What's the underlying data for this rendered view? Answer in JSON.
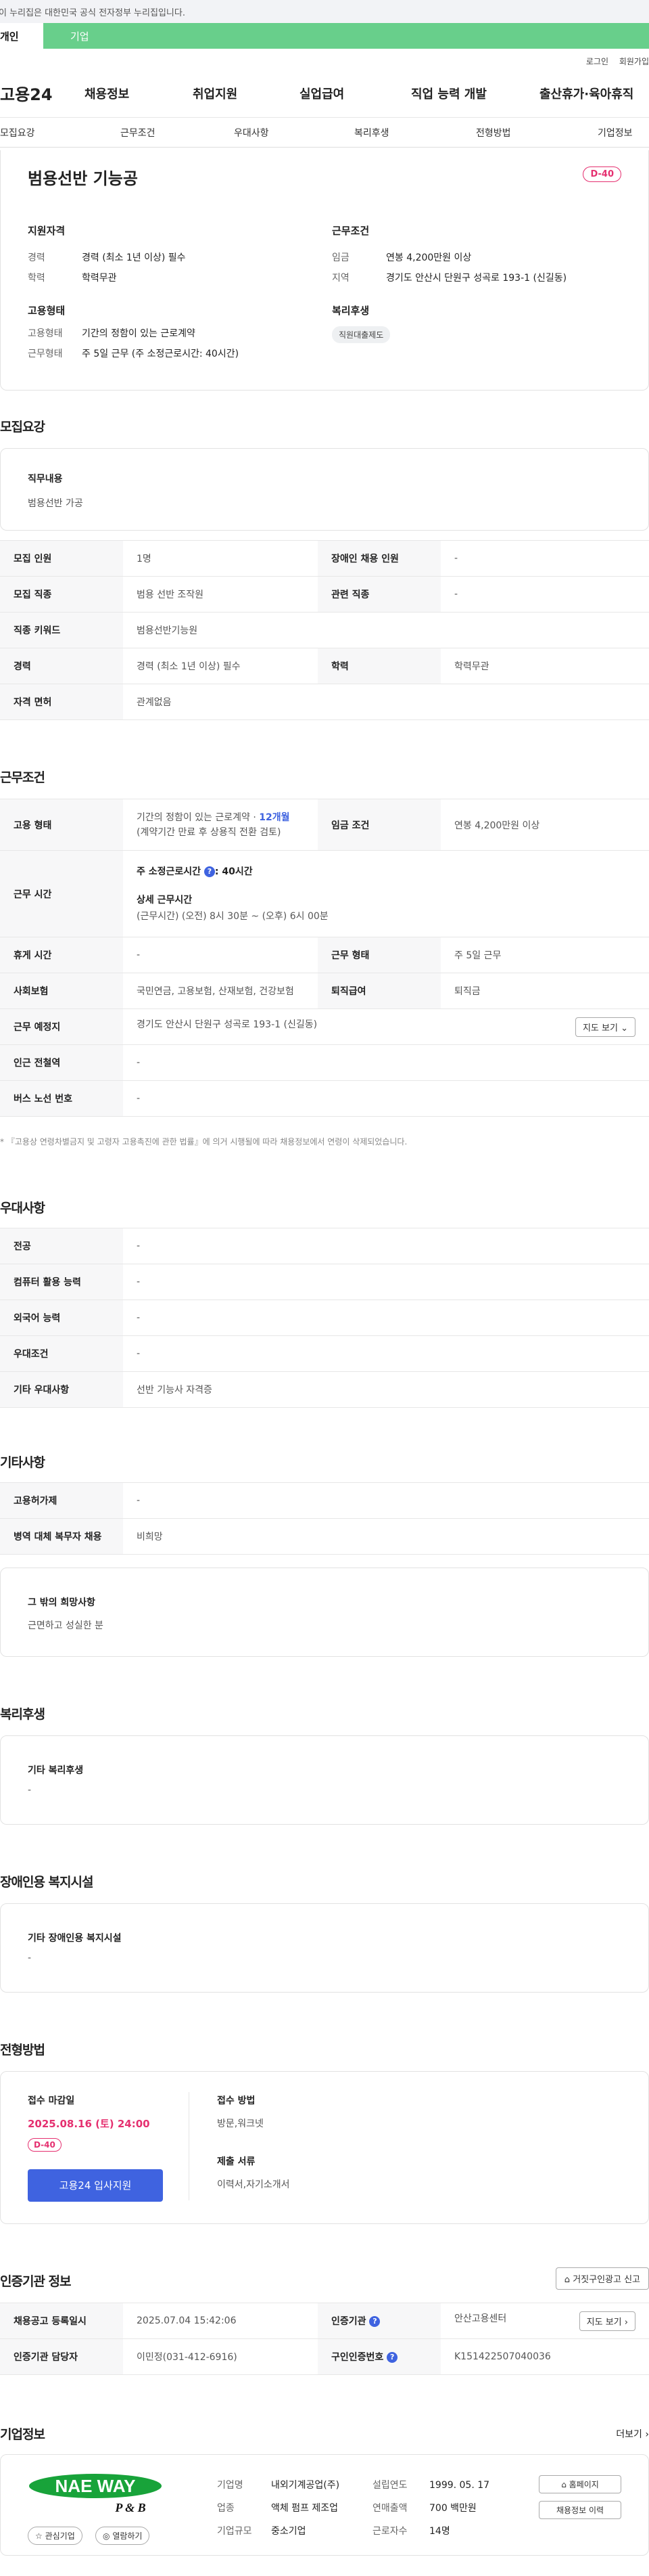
{
  "gov_banner": "이 누리집은 대한민국 공식 전자정부 누리집입니다.",
  "user_tabs": [
    "개인",
    "기업"
  ],
  "util": [
    "로그인",
    "회원가입"
  ],
  "logo": "고용24",
  "gnb": [
    "채용정보",
    "취업지원",
    "실업급여",
    "직업 능력 개발",
    "출산휴가·육아휴직"
  ],
  "subnav": [
    "모집요강",
    "근무조건",
    "우대사항",
    "복리후생",
    "전형방법",
    "기업정보"
  ],
  "summary": {
    "title": "범용선반 기능공",
    "dday": "D-40",
    "qual_h": "지원자격",
    "cond_h": "근무조건",
    "rows": [
      [
        "경력",
        "경력 (최소 1년 이상) 필수"
      ],
      [
        "학력",
        "학력무관"
      ]
    ],
    "crows": [
      [
        "임금",
        "연봉 4,200만원 이상"
      ],
      [
        "지역",
        "경기도 안산시 단원구 성곡로 193-1 (신길동)"
      ]
    ],
    "emp_h": "고용형태",
    "ben_h": "복리후생",
    "erows": [
      [
        "고용형태",
        "기간의 정함이 있는 근로계약"
      ],
      [
        "근무형태",
        "주 5일 근무 (주 소정근로시간: 40시간)"
      ]
    ],
    "ben_tag": "직원대출제도"
  },
  "recruit": {
    "h": "모집요강",
    "duty_l": "직무내용",
    "duty_v": "범용선반 가공",
    "rows": [
      [
        "모집 인원",
        "1명",
        "장애인 채용 인원",
        "-"
      ],
      [
        "모집 직종",
        "범용 선반 조작원",
        "관련 직종",
        "-"
      ],
      [
        "직종 키워드",
        "범용선반기능원"
      ],
      [
        "경력",
        "경력 (최소 1년 이상) 필수",
        "학력",
        "학력무관"
      ],
      [
        "자격 면허",
        "관계없음"
      ]
    ]
  },
  "work": {
    "h": "근무조건",
    "emp_l": "고용 형태",
    "emp_v1": "기간의 정함이 있는 근로계약 · ",
    "emp_v1b": "12개월",
    "emp_v2": "(계약기간 만료 후 상용직 전환 검토)",
    "wage_l": "임금 조건",
    "wage_v": "연봉 4,200만원 이상",
    "time_l": "근무 시간",
    "time_a": "주 소정근로시간",
    "time_a2": ": 40시간",
    "time_b": "상세 근무시간",
    "time_c": "(근무시간) (오전) 8시 30분 ~ (오후) 6시 00분",
    "rest_l": "휴게 시간",
    "rest_v": "-",
    "type_l": "근무 형태",
    "type_v": "주 5일 근무",
    "ins_l": "사회보험",
    "ins_v": "국민연금, 고용보험, 산재보험, 건강보험",
    "sev_l": "퇴직급여",
    "sev_v": "퇴직금",
    "loc_l": "근무 예정지",
    "loc_v": "경기도 안산시 단원구 성곡로 193-1 (신길동)",
    "map_btn": "지도 보기",
    "sub_l": "인근 전철역",
    "sub_v": "-",
    "bus_l": "버스 노선 번호",
    "bus_v": "-",
    "note": "* 『고용상 연령차별금지 및 고령자 고용촉진에 관한 법률』에 의거 시행될에 따라 채용정보에서 연령이 삭제되었습니다."
  },
  "pref": {
    "h": "우대사항",
    "rows": [
      [
        "전공",
        "-"
      ],
      [
        "컴퓨터 활용 능력",
        "-"
      ],
      [
        "외국어 능력",
        "-"
      ],
      [
        "우대조건",
        "-"
      ],
      [
        "기타 우대사항",
        "선반 기능사 자격증"
      ]
    ]
  },
  "etc": {
    "h": "기타사항",
    "rows": [
      [
        "고용허가제",
        "-"
      ],
      [
        "병역 대체 복무자 채용",
        "비희망"
      ]
    ],
    "wish_l": "그 밖의 희망사항",
    "wish_v": "근면하고 성실한 분"
  },
  "welfare": {
    "h": "복리후생",
    "l": "기타 복리후생",
    "v": "-"
  },
  "disab": {
    "h": "장애인용 복지시설",
    "l": "기타 장애인용 복지시설",
    "v": "-"
  },
  "proc": {
    "h": "전형방법",
    "deadline_l": "접수 마감일",
    "deadline_v": "2025.08.16 (토) 24:00",
    "dday": "D-40",
    "apply_btn": "고용24 입사지원",
    "method_l": "접수 방법",
    "method_v": "방문,워크넷",
    "docs_l": "제출 서류",
    "docs_v": "이력서,자기소개서"
  },
  "cert": {
    "h": "인증기관 정보",
    "report_btn": "거짓구인광고 신고",
    "rows": [
      [
        "채용공고 등록일시",
        "2025.07.04 15:42:06",
        "인증기관",
        "안산고용센터"
      ],
      [
        "인증기관 담당자",
        "이민정(031-412-6916)",
        "구인인증번호",
        "K151422507040036"
      ]
    ],
    "map_btn": "지도 보기"
  },
  "company": {
    "h": "기업정보",
    "more": "더보기",
    "logo_text": "NAE WAY",
    "logo_sub": "P & B",
    "fav_btn": "관심기업",
    "follow_btn": "열람하기",
    "rows": [
      [
        "기업명",
        "내외기계공업(주)",
        "설립연도",
        "1999. 05. 17"
      ],
      [
        "업종",
        "액체 펌프 제조업",
        "연매출액",
        "700 백만원"
      ],
      [
        "기업규모",
        "중소기업",
        "근로자수",
        "14명"
      ]
    ],
    "home_btn": "홈페이지",
    "list_btn": "채용정보 이력"
  },
  "colors": {
    "green": "#68cf8b",
    "blue": "#3f63e0",
    "pink": "#e53070"
  }
}
